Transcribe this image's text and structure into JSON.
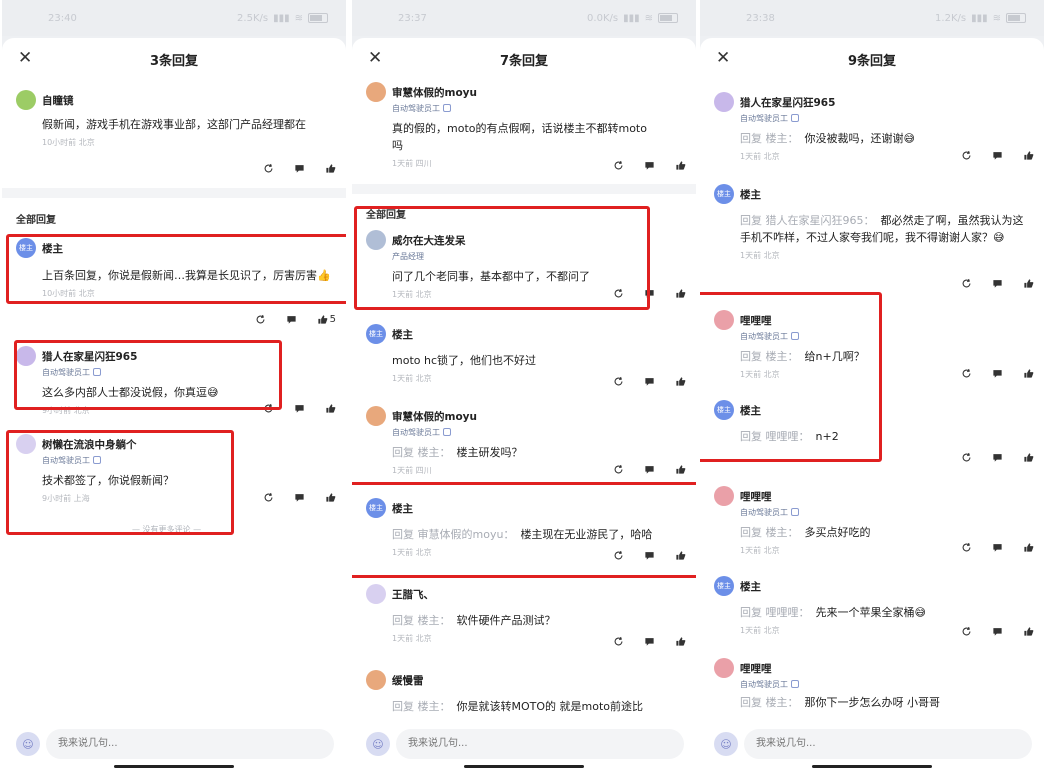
{
  "panels": [
    {
      "status": {
        "time": "23:40",
        "net": "2.5K/s"
      },
      "title": "3条回复",
      "top_comment": {
        "author": "自瞳镜",
        "text": "假新闻，游戏手机在游戏事业部，这部门产品经理都在",
        "meta": "10小时前 北京"
      },
      "section_label": "全部回复",
      "replies": [
        {
          "author": "楼主",
          "avatar_text": "楼主",
          "text": "上百条回复，你说是假新闻…我算是长见识了，厉害厉害👍",
          "meta": "10小时前 北京",
          "likes": "5"
        },
        {
          "author": "猎人在家星闪狂965",
          "badge": "自动驾驶员工",
          "text": "这么多内部人士都没说假，你真逗😅",
          "meta": "9小时前 北京"
        },
        {
          "author": "树懒在流浪中身躺个",
          "badge": "自动驾驶员工",
          "text": "技术都签了，你说假新闻？",
          "meta": "9小时前 上海"
        }
      ],
      "more": "— 没有更多评论 —",
      "input_placeholder": "我来说几句..."
    },
    {
      "status": {
        "time": "23:37",
        "net": "0.0K/s"
      },
      "title": "7条回复",
      "top_comment": {
        "author": "审慧体假的moyu",
        "badge": "自动驾驶员工",
        "text": "真的假的，moto的有点假啊，话说楼主不都转moto吗",
        "meta": "1天前 四川"
      },
      "section_label": "全部回复",
      "replies": [
        {
          "author": "威尔在大连发呆",
          "badge": "产品经理",
          "text": "问了几个老同事，基本都中了，不都问了",
          "meta": "1天前 北京"
        },
        {
          "author": "楼主",
          "avatar_text": "楼主",
          "text": "moto hc锁了，他们也不好过",
          "meta": "1天前 北京"
        },
        {
          "author": "审慧体假的moyu",
          "badge": "自动驾驶员工",
          "reply_to": "回复 楼主：",
          "text": "楼主研发吗？",
          "meta": "1天前 四川"
        },
        {
          "author": "楼主",
          "avatar_text": "楼主",
          "reply_to": "回复 审慧体假的moyu：",
          "text": "楼主现在无业游民了，哈哈",
          "meta": "1天前 北京"
        },
        {
          "author": "王腊飞、",
          "reply_to": "回复 楼主：",
          "text": "软件硬件产品测试？",
          "meta": "1天前 北京"
        },
        {
          "author": "缓慢雷",
          "reply_to": "回复 楼主：",
          "text": "你是就该转MOTO的 就是moto前途比",
          "meta": ""
        }
      ],
      "input_placeholder": "我来说几句..."
    },
    {
      "status": {
        "time": "23:38",
        "net": "1.2K/s"
      },
      "title": "9条回复",
      "replies": [
        {
          "author": "猎人在家星闪狂965",
          "badge": "自动驾驶员工",
          "reply_to": "回复 楼主：",
          "text": "你没被裁吗，还谢谢😅",
          "meta": "1天前 北京"
        },
        {
          "author": "楼主",
          "avatar_text": "楼主",
          "reply_to": "回复 猎人在家星闪狂965：",
          "text": "都必然走了啊，虽然我认为这手机不咋样，不过人家夸我们呢，我不得谢谢人家？😅",
          "meta": "1天前 北京"
        },
        {
          "author": "哩哩哩",
          "badge": "自动驾驶员工",
          "reply_to": "回复 楼主：",
          "text": "给n+几啊？",
          "meta": "1天前 北京"
        },
        {
          "author": "楼主",
          "avatar_text": "楼主",
          "reply_to": "回复 哩哩哩：",
          "text": "n+2",
          "meta": ""
        },
        {
          "author": "哩哩哩",
          "badge": "自动驾驶员工",
          "reply_to": "回复 楼主：",
          "text": "多买点好吃的",
          "meta": "1天前 北京"
        },
        {
          "author": "楼主",
          "avatar_text": "楼主",
          "reply_to": "回复 哩哩哩：",
          "text": "先来一个苹果全家桶😅",
          "meta": "1天前 北京"
        },
        {
          "author": "哩哩哩",
          "badge": "自动驾驶员工",
          "reply_to": "回复 楼主：",
          "text": "那你下一步怎么办呀 小哥哥",
          "meta": ""
        }
      ],
      "input_placeholder": "我来说几句..."
    }
  ]
}
